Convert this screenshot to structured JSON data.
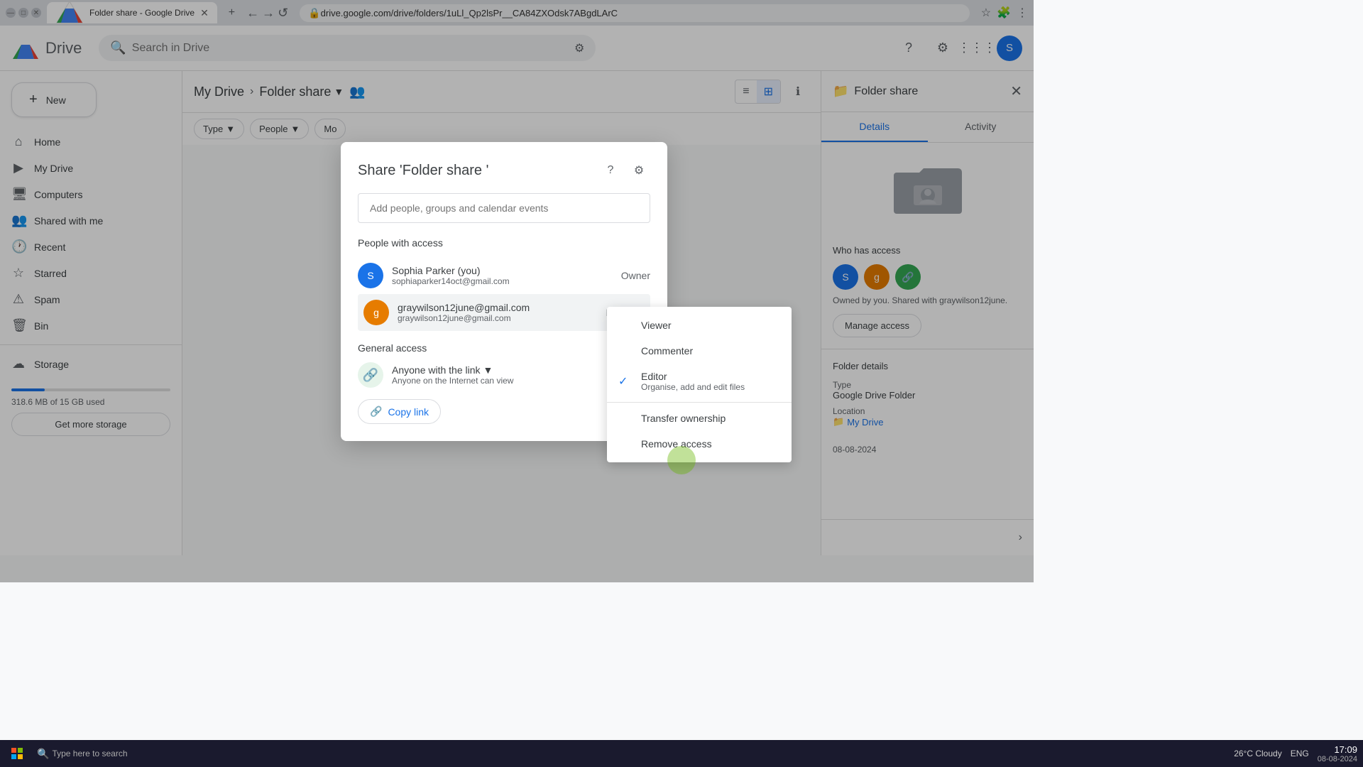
{
  "browser": {
    "tab_title": "Folder share - Google Drive",
    "url": "drive.google.com/drive/folders/1uLl_Qp2lsPr__CA84ZXOdsk7ABgdLArC",
    "new_tab": "+"
  },
  "topnav": {
    "logo_text": "Drive",
    "search_placeholder": "Search in Drive",
    "avatar_letter": "S"
  },
  "sidebar": {
    "new_label": "New",
    "items": [
      {
        "id": "home",
        "label": "Home",
        "icon": "⌂"
      },
      {
        "id": "my-drive",
        "label": "My Drive",
        "icon": "▶"
      },
      {
        "id": "computers",
        "label": "Computers",
        "icon": "🖥"
      },
      {
        "id": "shared",
        "label": "Shared with me",
        "icon": "👥"
      },
      {
        "id": "recent",
        "label": "Recent",
        "icon": "🕐"
      },
      {
        "id": "starred",
        "label": "Starred",
        "icon": "☆"
      },
      {
        "id": "spam",
        "label": "Spam",
        "icon": "⚠"
      },
      {
        "id": "bin",
        "label": "Bin",
        "icon": "🗑"
      },
      {
        "id": "storage",
        "label": "Storage",
        "icon": "☁"
      }
    ],
    "storage_text": "318.6 MB of 15 GB used",
    "get_more_label": "Get more storage"
  },
  "breadcrumb": {
    "parent": "My Drive",
    "current": "Folder share"
  },
  "filters": {
    "type_label": "Type",
    "people_label": "People",
    "modified_label": "Mo"
  },
  "right_panel": {
    "title": "Folder share",
    "close_icon": "✕",
    "tabs": [
      "Details",
      "Activity"
    ],
    "active_tab": "Details",
    "who_has_access": "Who has access",
    "access_text": "Owned by you. Shared with graywilson12june.",
    "manage_access_label": "Manage access",
    "folder_details_label": "Folder details",
    "type_label": "Type",
    "type_value": "Google Drive Folder",
    "location_label": "Location",
    "location_value": "My Drive",
    "date_label": "08-08-2024"
  },
  "modal": {
    "title": "Share 'Folder share '",
    "input_placeholder": "Add people, groups and calendar events",
    "people_with_access_label": "People with access",
    "general_access_label": "General access",
    "owner": {
      "name": "Sophia Parker (you)",
      "email": "sophiaparker14oct@gmail.com",
      "role": "Owner",
      "avatar_letter": "S",
      "avatar_color": "#1a73e8"
    },
    "shared_user": {
      "name": "graywilson12june@gmail.com",
      "email": "graywilson12june@gmail.com",
      "role": "Editor",
      "avatar_color": "#e67c00"
    },
    "general_access": {
      "title": "Anyone with the link",
      "description": "Anyone on the Internet can view",
      "icon": "🔗"
    },
    "copy_link_label": "Copy link"
  },
  "dropdown": {
    "items": [
      {
        "id": "viewer",
        "label": "Viewer",
        "checked": false
      },
      {
        "id": "commenter",
        "label": "Commenter",
        "checked": false
      },
      {
        "id": "editor",
        "label": "Editor",
        "checked": true,
        "sub": "Organise, add and edit files"
      }
    ],
    "transfer_label": "Transfer ownership",
    "remove_label": "Remove access"
  },
  "taskbar": {
    "start_label": "",
    "search_placeholder": "Type here to search",
    "time": "17:09",
    "date": "08-08-2024",
    "temp": "26°C  Cloudy",
    "lang": "ENG"
  }
}
